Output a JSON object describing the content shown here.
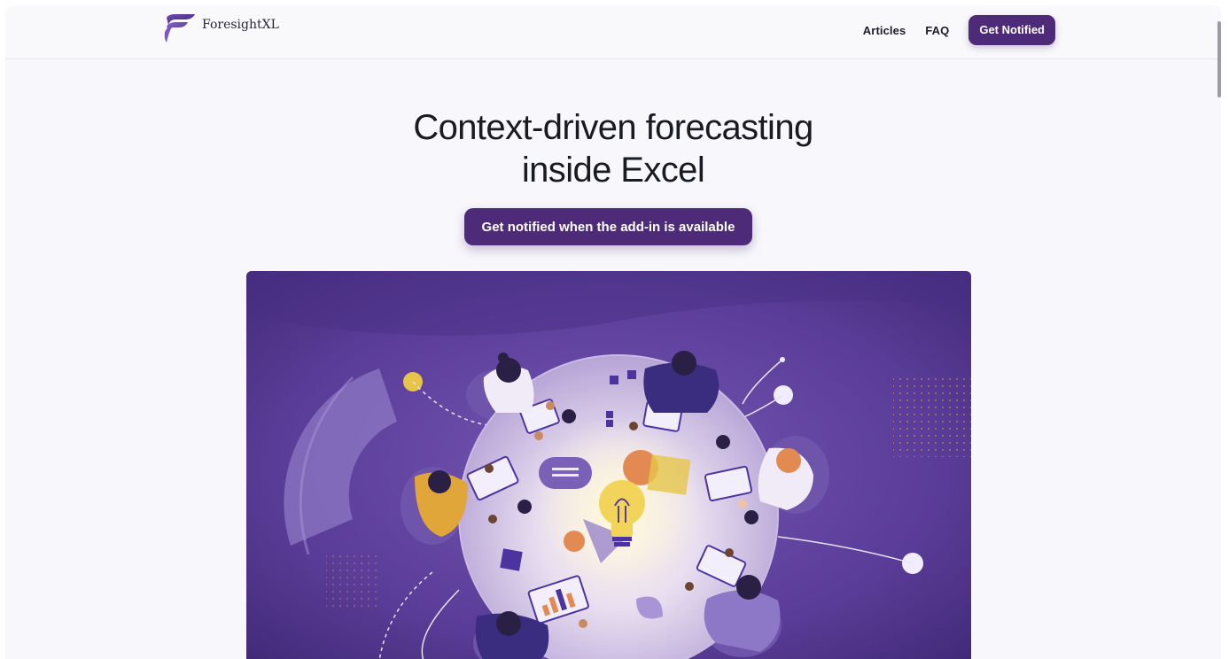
{
  "header": {
    "brand_name": "ForesightXL",
    "nav": {
      "articles": "Articles",
      "faq": "FAQ",
      "cta": "Get Notified"
    }
  },
  "hero": {
    "title_line1": "Context-driven forecasting",
    "title_line2": "inside Excel",
    "cta": "Get notified when the add-in is available"
  },
  "colors": {
    "brand": "#4e2b78",
    "background": "#f8f8fc",
    "text": "#1a1a22",
    "illustration_bg": "#5b3f99",
    "table": "#e3d8ee",
    "accent_orange": "#e28a52",
    "accent_yellow": "#e6c54a"
  },
  "icons": {
    "logo": "brand-f-icon",
    "illustration_center": "lightbulb-icon"
  }
}
